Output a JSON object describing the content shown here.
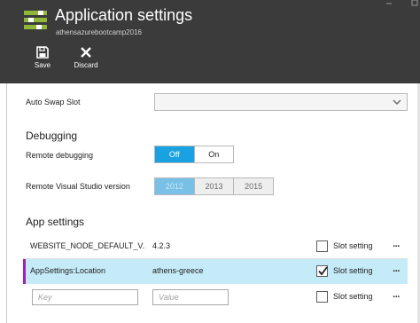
{
  "header": {
    "title": "Application settings",
    "subtitle": "athensazurebootcamp2016",
    "app_icon": "app-settings-icon",
    "bg_color": "#3b3b3b",
    "accent_color": "#8fb836"
  },
  "toolbar": {
    "save_label": "Save",
    "save_icon": "floppy-disk-icon",
    "discard_label": "Discard",
    "discard_icon": "close-x-icon"
  },
  "auto_swap": {
    "label": "Auto Swap Slot",
    "selected": ""
  },
  "debugging": {
    "heading": "Debugging",
    "remote_debugging": {
      "label": "Remote debugging",
      "options": [
        "Off",
        "On"
      ],
      "selected": "Off"
    },
    "remote_vs_version": {
      "label": "Remote Visual Studio version",
      "options": [
        "2012",
        "2013",
        "2015"
      ],
      "selected": "2012"
    }
  },
  "app_settings": {
    "heading": "App settings",
    "slot_setting_label": "Slot setting",
    "more_label": "...",
    "rows": [
      {
        "key": "WEBSITE_NODE_DEFAULT_V...",
        "value": "4.2.3",
        "slot_setting": false
      },
      {
        "key": "AppSettings:Location",
        "value": "athens-greece",
        "slot_setting": true
      }
    ],
    "new_row": {
      "key_placeholder": "Key",
      "value_placeholder": "Value",
      "slot_setting": false
    }
  },
  "colors": {
    "selected_toggle": "#1aa1e1",
    "selected_row": "#c6ebf8",
    "row_accent": "#a020b8"
  }
}
